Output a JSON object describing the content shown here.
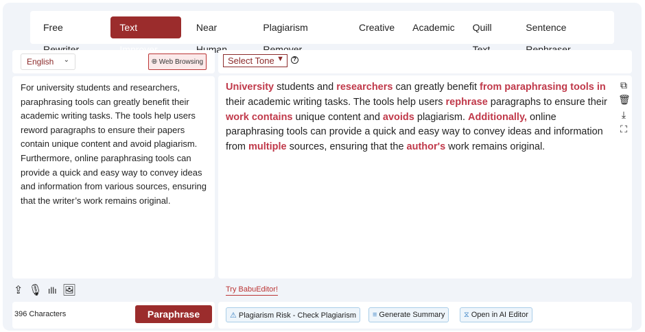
{
  "tabs": [
    "Free Rewriter",
    "Text Improver",
    "Near Human",
    "Plagiarism Remover",
    "Creative",
    "Academic",
    "Quill Text",
    "Sentence Rephraser"
  ],
  "active_tab": "Text Improver",
  "left": {
    "language": "English",
    "web_browsing": "Web Browsing",
    "input_text": "For university students and researchers, paraphrasing tools can greatly benefit their academic writing tasks. The tools help users reword paragraphs to ensure their papers contain unique content and avoid plagiarism. Furthermore, online paraphrasing tools can provide a quick and easy way to convey ideas and information from various sources, ensuring that the writer’s work remains original.",
    "char_count": "396 Characters",
    "paraphrase_label": "Paraphrase"
  },
  "right": {
    "tone_select": "Select Tone",
    "help": "?",
    "try_editor": "Try BabuEditor!",
    "segments": [
      {
        "t": "University",
        "h": true
      },
      {
        "t": " students and ",
        "h": false
      },
      {
        "t": "researchers",
        "h": true
      },
      {
        "t": " can greatly benefit ",
        "h": false
      },
      {
        "t": "from paraphrasing tools in",
        "h": true
      },
      {
        "t": " their academic writing tasks. The tools help users ",
        "h": false
      },
      {
        "t": "rephrase",
        "h": true
      },
      {
        "t": " paragraphs to ensure their ",
        "h": false
      },
      {
        "t": "work contains",
        "h": true
      },
      {
        "t": " unique content and ",
        "h": false
      },
      {
        "t": "avoids",
        "h": true
      },
      {
        "t": " plagiarism. ",
        "h": false
      },
      {
        "t": "Additionally,",
        "h": true
      },
      {
        "t": " online paraphrasing tools can provide a quick and easy way to convey ideas and information from ",
        "h": false
      },
      {
        "t": "multiple",
        "h": true
      },
      {
        "t": " sources, ensuring that the ",
        "h": false
      },
      {
        "t": "author's",
        "h": true
      },
      {
        "t": " work remains original.",
        "h": false
      }
    ],
    "actions": [
      "Plagiarism Risk - Check Plagiarism",
      "Generate Summary",
      "Open in AI Editor"
    ]
  },
  "colors": {
    "accent": "#9b2c2c",
    "highlight": "#c0394a"
  }
}
